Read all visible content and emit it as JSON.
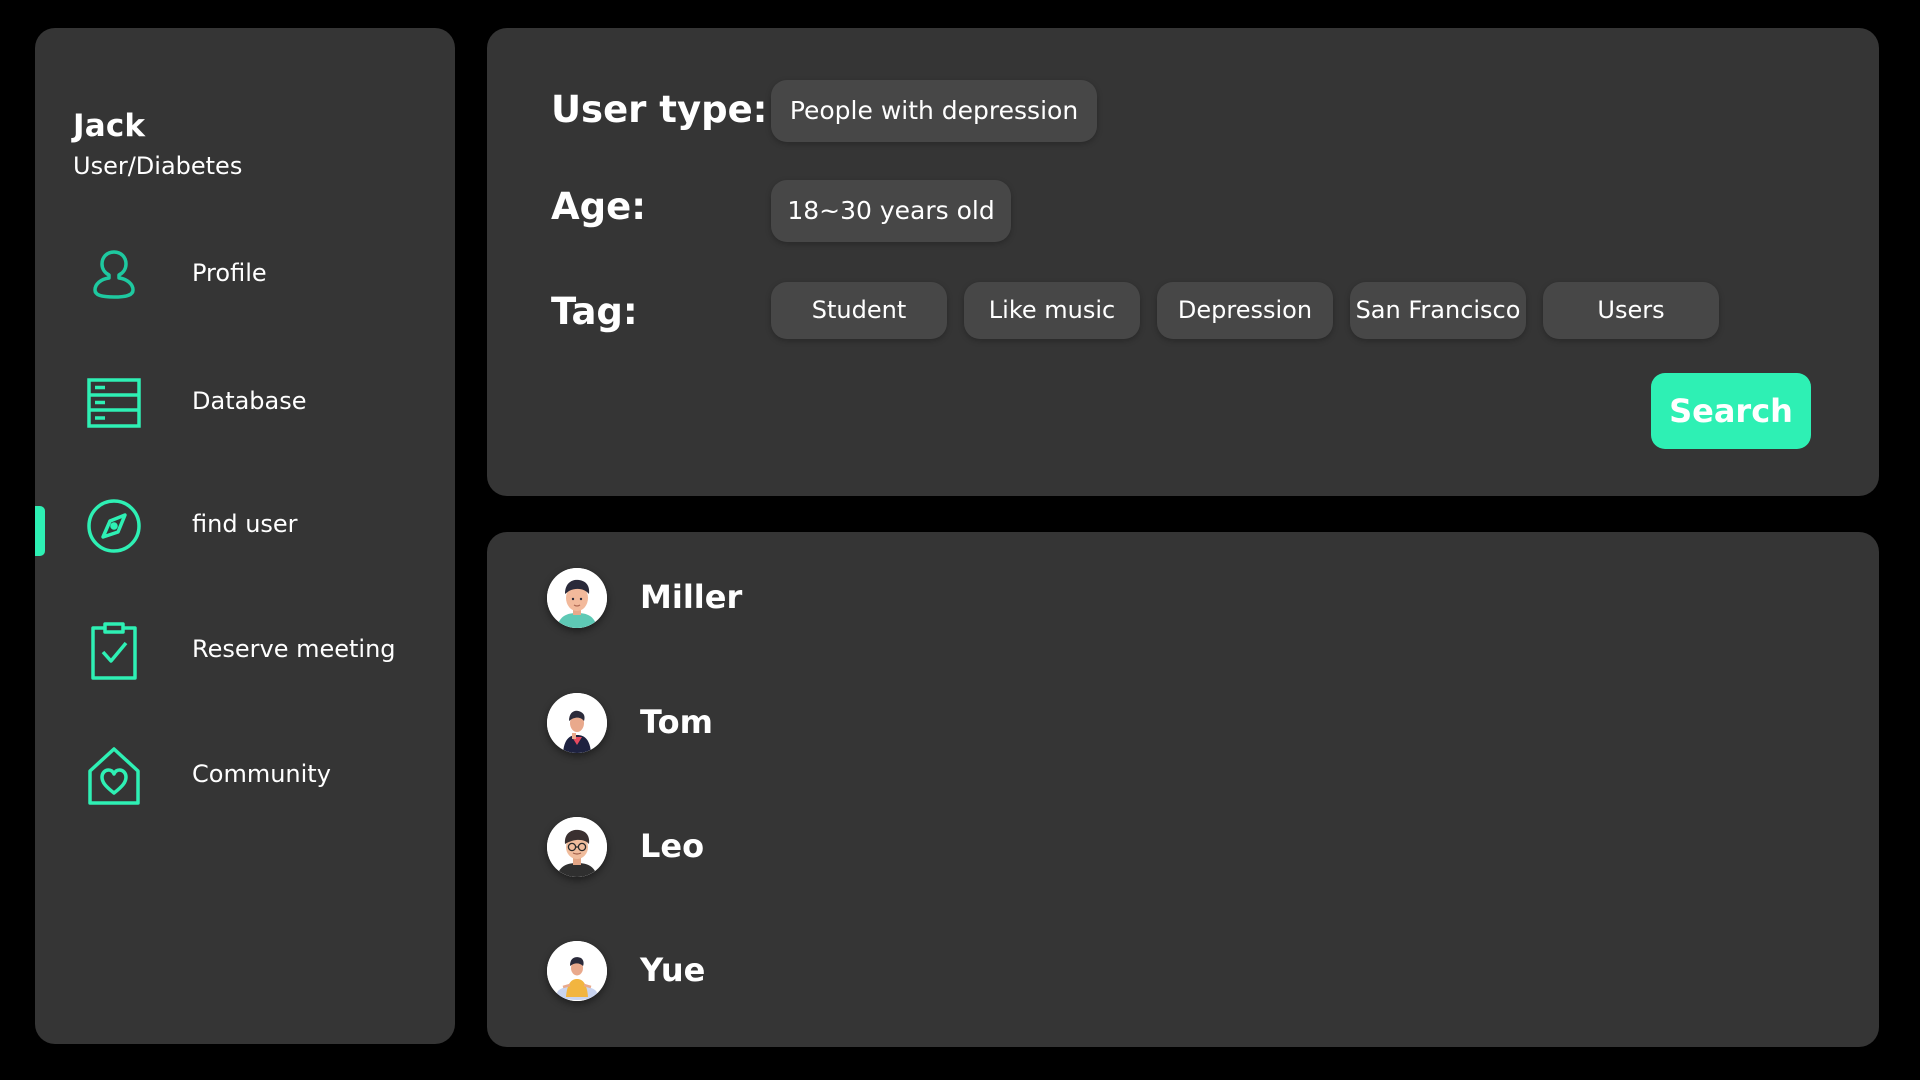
{
  "colors": {
    "accent": "#2ef0b4",
    "panel": "#353535",
    "chip": "#474747",
    "background": "#000000"
  },
  "user": {
    "name": "Jack",
    "role": "User/Diabetes"
  },
  "sidebar": {
    "items": [
      {
        "label": "Profile",
        "icon": "person-icon",
        "active": false
      },
      {
        "label": "Database",
        "icon": "database-list-icon",
        "active": false
      },
      {
        "label": "find user",
        "icon": "compass-icon",
        "active": true
      },
      {
        "label": "Reserve meeting",
        "icon": "clipboard-check-icon",
        "active": false
      },
      {
        "label": "Community",
        "icon": "home-heart-icon",
        "active": false
      }
    ]
  },
  "filters": {
    "user_type_label": "User type:",
    "user_type_value": "People with depression",
    "age_label": "Age:",
    "age_value": "18~30 years old",
    "tag_label": "Tag:",
    "tags": [
      "Student",
      "Like music",
      "Depression",
      "San Francisco",
      "Users"
    ],
    "search_label": "Search"
  },
  "results": [
    {
      "name": "Miller",
      "avatar": "avatar-miller-icon"
    },
    {
      "name": "Tom",
      "avatar": "avatar-tom-icon"
    },
    {
      "name": "Leo",
      "avatar": "avatar-leo-icon"
    },
    {
      "name": "Yue",
      "avatar": "avatar-yue-icon"
    }
  ]
}
